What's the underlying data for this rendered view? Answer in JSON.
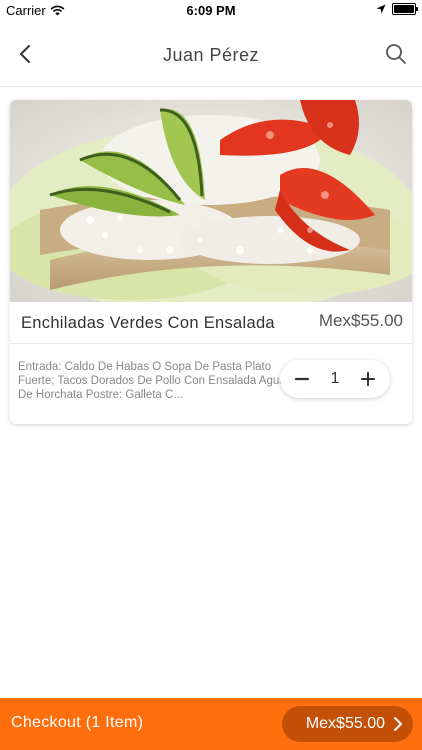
{
  "status_bar": {
    "carrier": "Carrier",
    "time": "6:09 PM",
    "icons": [
      "wifi-icon",
      "location-icon",
      "battery-icon"
    ]
  },
  "header": {
    "title": "Juan Pérez",
    "back_icon": "chevron-left-icon",
    "search_icon": "search-icon"
  },
  "product": {
    "name": "Enchiladas Verdes Con Ensalada",
    "price": "Mex$55.00",
    "description": "Entrada: Caldo De Habas O Sopa De Pasta Plato Fuerte; Tacos Dorados De Pollo Con Ensalada Agua De Horchata Postre: Galleta C...",
    "quantity": "1",
    "decrement_icon": "minus-icon",
    "increment_icon": "plus-icon"
  },
  "checkout": {
    "label": "Checkout (1 Item)",
    "total": "Mex$55.00",
    "arrow_icon": "chevron-right-icon"
  },
  "colors": {
    "accent": "#ff6e0c",
    "accent_dark": "#c25107"
  }
}
